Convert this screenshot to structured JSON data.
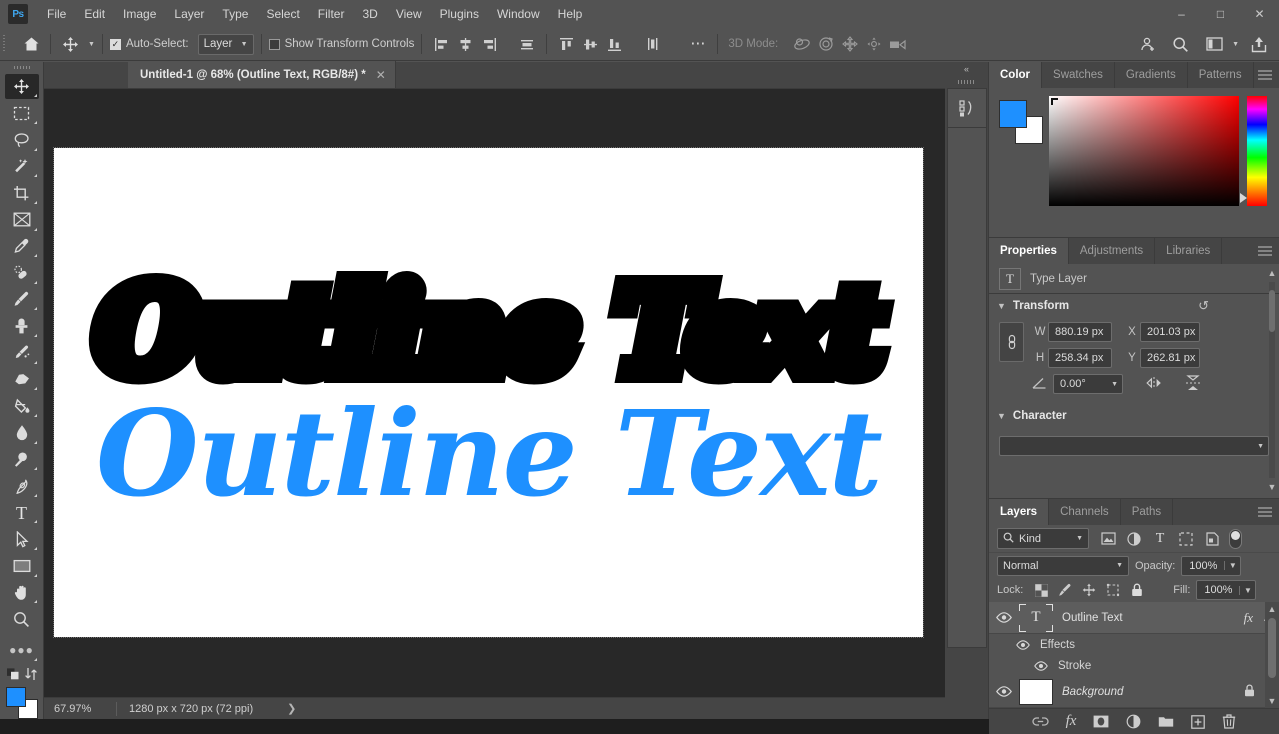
{
  "app": {
    "name": "Adobe Photoshop",
    "logo_text": "Ps",
    "accent": "#1e90ff",
    "ui_bg": "#535353",
    "canvas_bg": "#282828"
  },
  "menubar": {
    "items": [
      "File",
      "Edit",
      "Image",
      "Layer",
      "Type",
      "Select",
      "Filter",
      "3D",
      "View",
      "Plugins",
      "Window",
      "Help"
    ],
    "window_controls": {
      "minimize": "–",
      "maximize": "□",
      "close": "✕"
    }
  },
  "options_bar": {
    "home_icon": "home-icon",
    "tool_icon": "move-tool-icon",
    "auto_select_label": "Auto-Select:",
    "auto_select_checked": true,
    "auto_select_scope": "Layer",
    "show_transform_label": "Show Transform Controls",
    "show_transform_checked": false,
    "align_icons": [
      "align-left-edges-icon",
      "align-horizontal-centers-icon",
      "align-right-edges-icon",
      "distribute-horizontal-icon",
      "align-top-edges-icon",
      "align-vertical-centers-icon",
      "align-bottom-edges-icon",
      "distribute-vertical-icon"
    ],
    "more_icon": "more-options-icon",
    "mode_3d_label": "3D Mode:",
    "mode_3d_icons": [
      "orbit-3d-icon",
      "roll-3d-icon",
      "pan-3d-icon",
      "slide-3d-icon",
      "camera-3d-icon"
    ],
    "right_icons": [
      "share-document-icon",
      "search-icon",
      "workspace-switcher-icon",
      "chevron-down-icon",
      "export-icon"
    ]
  },
  "toolbar": {
    "tools": [
      {
        "name": "move-tool",
        "icon": "move-tool-icon",
        "active": true
      },
      {
        "name": "rectangular-marquee-tool",
        "icon": "marquee-icon",
        "active": false
      },
      {
        "name": "lasso-tool",
        "icon": "lasso-icon",
        "active": false
      },
      {
        "name": "object-selection-tool",
        "icon": "magic-wand-icon",
        "active": false
      },
      {
        "name": "crop-tool",
        "icon": "crop-icon",
        "active": false
      },
      {
        "name": "frame-tool",
        "icon": "frame-icon",
        "active": false
      },
      {
        "name": "eyedropper-tool",
        "icon": "eyedropper-icon",
        "active": false
      },
      {
        "name": "spot-healing-brush-tool",
        "icon": "healing-brush-icon",
        "active": false
      },
      {
        "name": "brush-tool",
        "icon": "brush-icon",
        "active": false
      },
      {
        "name": "clone-stamp-tool",
        "icon": "clone-stamp-icon",
        "active": false
      },
      {
        "name": "history-brush-tool",
        "icon": "history-brush-icon",
        "active": false
      },
      {
        "name": "eraser-tool",
        "icon": "eraser-icon",
        "active": false
      },
      {
        "name": "gradient-tool",
        "icon": "paint-bucket-icon",
        "active": false
      },
      {
        "name": "blur-tool",
        "icon": "blur-drop-icon",
        "active": false
      },
      {
        "name": "dodge-tool",
        "icon": "dodge-icon",
        "active": false
      },
      {
        "name": "pen-tool",
        "icon": "pen-icon",
        "active": false
      },
      {
        "name": "horizontal-type-tool",
        "icon": "type-icon",
        "active": false
      },
      {
        "name": "path-selection-tool",
        "icon": "path-arrow-icon",
        "active": false
      },
      {
        "name": "rectangle-tool",
        "icon": "rectangle-shape-icon",
        "active": false
      },
      {
        "name": "hand-tool",
        "icon": "hand-icon",
        "active": false
      },
      {
        "name": "zoom-tool",
        "icon": "zoom-magnifier-icon",
        "active": false
      }
    ],
    "edit_toolbar_icon": "ellipsis-icon",
    "quick_mask_icon": "quick-mask-icon",
    "screen_mode_icon": "screen-mode-icon",
    "foreground_color": "#1e90ff",
    "background_color": "#ffffff"
  },
  "document_tab": {
    "title": "Untitled-1 @ 68% (Outline Text, RGB/8#) *",
    "close_icon": "close-icon"
  },
  "canvas": {
    "artwork_text": "Outline Text",
    "text_fill_color": "#1e90ff",
    "stroke_color": "#000000",
    "document_background": "#ffffff"
  },
  "status_bar": {
    "zoom": "67.97%",
    "doc_info": "1280 px x 720 px (72 ppi)",
    "expand_icon": "chevron-right-icon"
  },
  "collapsed_panels": {
    "collapse_icon": "double-chevron-left-icon",
    "items": [
      {
        "name": "history-panel",
        "icon": "history-icon"
      }
    ]
  },
  "color_panel": {
    "tabs": [
      "Color",
      "Swatches",
      "Gradients",
      "Patterns"
    ],
    "active_tab": "Color",
    "menu_icon": "panel-menu-icon",
    "foreground_color": "#1e90ff",
    "background_color": "#ffffff"
  },
  "properties_panel": {
    "tabs": [
      "Properties",
      "Adjustments",
      "Libraries"
    ],
    "active_tab": "Properties",
    "menu_icon": "panel-menu-icon",
    "layer_type_icon": "type-layer-icon",
    "layer_type_label": "Type Layer",
    "transform": {
      "section_title": "Transform",
      "reset_icon": "reset-icon",
      "link_icon": "link-aspect-ratio-icon",
      "w_label": "W",
      "w_value": "880.19 px",
      "h_label": "H",
      "h_value": "258.34 px",
      "x_label": "X",
      "x_value": "201.03 px",
      "y_label": "Y",
      "y_value": "262.81 px",
      "angle_icon": "angle-icon",
      "angle_value": "0.00°",
      "flip_horizontal_icon": "flip-horizontal-icon",
      "flip_vertical_icon": "flip-vertical-icon"
    },
    "character": {
      "section_title": "Character",
      "font_family": ""
    }
  },
  "layers_panel": {
    "tabs": [
      "Layers",
      "Channels",
      "Paths"
    ],
    "active_tab": "Layers",
    "menu_icon": "panel-menu-icon",
    "filter": {
      "search_icon": "search-icon",
      "kind_label": "Kind",
      "type_filters": [
        "pixel-filter-icon",
        "adjustment-filter-icon",
        "type-filter-icon",
        "shape-filter-icon",
        "smart-object-filter-icon"
      ],
      "toggle_icon": "filter-toggle-icon"
    },
    "blend_mode": "Normal",
    "opacity_label": "Opacity:",
    "opacity_value": "100%",
    "lock_label": "Lock:",
    "lock_icons": [
      "lock-transparency-icon",
      "lock-image-icon",
      "lock-position-icon",
      "lock-artboard-icon",
      "lock-all-icon"
    ],
    "fill_label": "Fill:",
    "fill_value": "100%",
    "layers": [
      {
        "name": "Outline Text",
        "visible": true,
        "selected": true,
        "type": "text",
        "has_fx": true,
        "fx_badge": "fx",
        "expanded": true,
        "children": [
          {
            "name": "Effects",
            "visible": true,
            "indent": 1
          },
          {
            "name": "Stroke",
            "visible": true,
            "indent": 2
          }
        ]
      },
      {
        "name": "Background",
        "visible": true,
        "selected": false,
        "type": "image",
        "locked": true,
        "italic": true
      }
    ],
    "footer_buttons": [
      {
        "name": "link-layers-button",
        "icon": "link-icon"
      },
      {
        "name": "layer-style-button",
        "icon": "fx-icon"
      },
      {
        "name": "layer-mask-button",
        "icon": "mask-icon"
      },
      {
        "name": "adjustment-layer-button",
        "icon": "half-circle-icon"
      },
      {
        "name": "new-group-button",
        "icon": "folder-icon"
      },
      {
        "name": "new-layer-button",
        "icon": "plus-square-icon"
      },
      {
        "name": "delete-layer-button",
        "icon": "trash-icon"
      }
    ]
  }
}
